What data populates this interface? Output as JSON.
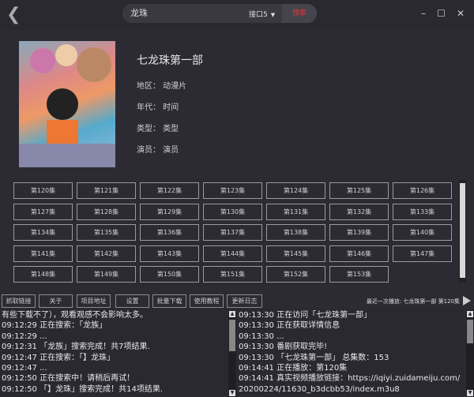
{
  "search": {
    "value": "龙珠",
    "source": "接口5",
    "button": "搜索"
  },
  "window": {
    "minimize": "–",
    "maximize": "☐",
    "close": "✕",
    "back": "❮"
  },
  "show": {
    "title": "七龙珠第一部",
    "region": "地区：  动漫片",
    "year": "年代：  时间",
    "genre": "类型：  类型",
    "actors": "演员：  演员"
  },
  "episodes": [
    "第120集",
    "第121集",
    "第122集",
    "第123集",
    "第124集",
    "第125集",
    "第126集",
    "第127集",
    "第128集",
    "第129集",
    "第130集",
    "第131集",
    "第132集",
    "第133集",
    "第134集",
    "第135集",
    "第136集",
    "第137集",
    "第138集",
    "第139集",
    "第140集",
    "第141集",
    "第142集",
    "第143集",
    "第144集",
    "第145集",
    "第146集",
    "第147集",
    "第148集",
    "第149集",
    "第150集",
    "第151集",
    "第152集",
    "第153集"
  ],
  "toolbar": [
    "抓取链接",
    "关于",
    "项目地址",
    "设置",
    "批量下载",
    "使用教程",
    "更新日志"
  ],
  "last_played": "最近一次播放:  七龙珠第一部  第120集",
  "log_left": [
    "有些下载不了），观看观感不会影响太多。",
    "09:12:29 正在搜索：「龙族」",
    "09:12:29 ...",
    "09:12:31 「龙族」搜索完成！共7项结果.",
    "09:12:47 正在搜索：「】龙珠」",
    "09:12:47 ...",
    "09:12:50 正在搜索中！请稍后再试！",
    "09:12:50 「】龙珠」搜索完成！共14项结果."
  ],
  "log_right": [
    "09:13:30 正在访问「七龙珠第一部」",
    "09:13:30 正在获取详情信息",
    "09:13:30 ...",
    "09:13:30 番剧获取完毕!",
    "09:13:30 「七龙珠第一部」 总集数：153",
    "09:14:41 正在播放：第120集",
    "09:14:41 真实视频播放链接：https://iqiyi.zuidameiju.com/",
    "20200224/11630_b3dcbb53/index.m3u8"
  ]
}
